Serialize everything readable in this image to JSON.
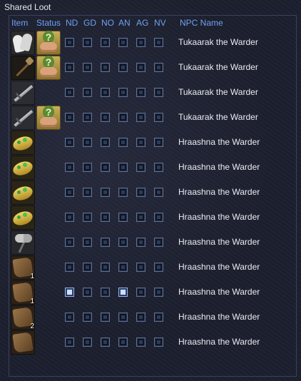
{
  "window": {
    "title": "Shared Loot"
  },
  "columns": {
    "item": "Item",
    "status": "Status",
    "nd": "ND",
    "gd": "GD",
    "no": "NO",
    "an": "AN",
    "ag": "AG",
    "nv": "NV",
    "npc": "NPC Name"
  },
  "rows": [
    {
      "icon": "gloves-icon",
      "status_icon": "unknown-status-icon",
      "qty": "",
      "checks": [
        false,
        false,
        false,
        false,
        false,
        false
      ],
      "npc": "Tukaarak the Warder"
    },
    {
      "icon": "mace-icon",
      "status_icon": "unknown-status-icon",
      "qty": "",
      "checks": [
        false,
        false,
        false,
        false,
        false,
        false
      ],
      "npc": "Tukaarak the Warder"
    },
    {
      "icon": "sword-icon",
      "status_icon": "",
      "qty": "",
      "checks": [
        false,
        false,
        false,
        false,
        false,
        false
      ],
      "npc": "Tukaarak the Warder"
    },
    {
      "icon": "sword-icon",
      "status_icon": "unknown-status-icon",
      "qty": "",
      "checks": [
        false,
        false,
        false,
        false,
        false,
        false
      ],
      "npc": "Tukaarak the Warder"
    },
    {
      "icon": "gold-band-icon",
      "status_icon": "",
      "qty": "",
      "checks": [
        false,
        false,
        false,
        false,
        false,
        false
      ],
      "npc": "Hraashna the Warder"
    },
    {
      "icon": "gold-band-icon",
      "status_icon": "",
      "qty": "",
      "checks": [
        false,
        false,
        false,
        false,
        false,
        false
      ],
      "npc": "Hraashna the Warder"
    },
    {
      "icon": "gold-band-icon",
      "status_icon": "",
      "qty": "",
      "checks": [
        false,
        false,
        false,
        false,
        false,
        false
      ],
      "npc": "Hraashna the Warder"
    },
    {
      "icon": "gold-band-icon",
      "status_icon": "",
      "qty": "",
      "checks": [
        false,
        false,
        false,
        false,
        false,
        false
      ],
      "npc": "Hraashna the Warder"
    },
    {
      "icon": "axe-icon",
      "status_icon": "",
      "qty": "",
      "checks": [
        false,
        false,
        false,
        false,
        false,
        false
      ],
      "npc": "Hraashna the Warder"
    },
    {
      "icon": "hide-icon",
      "status_icon": "",
      "qty": "1",
      "checks": [
        false,
        false,
        false,
        false,
        false,
        false
      ],
      "npc": "Hraashna the Warder"
    },
    {
      "icon": "hide-icon",
      "status_icon": "",
      "qty": "1",
      "checks": [
        true,
        false,
        false,
        true,
        false,
        false
      ],
      "npc": "Hraashna the Warder"
    },
    {
      "icon": "hide-icon",
      "status_icon": "",
      "qty": "2",
      "checks": [
        false,
        false,
        false,
        false,
        false,
        false
      ],
      "npc": "Hraashna the Warder"
    },
    {
      "icon": "hide-icon",
      "status_icon": "",
      "qty": "",
      "checks": [
        false,
        false,
        false,
        false,
        false,
        false
      ],
      "npc": "Hraashna the Warder"
    }
  ],
  "colors": {
    "header": "#6fa0f0",
    "text": "#e9ebf2",
    "background": "#1c1f2d",
    "checked": "#2e4a86"
  }
}
